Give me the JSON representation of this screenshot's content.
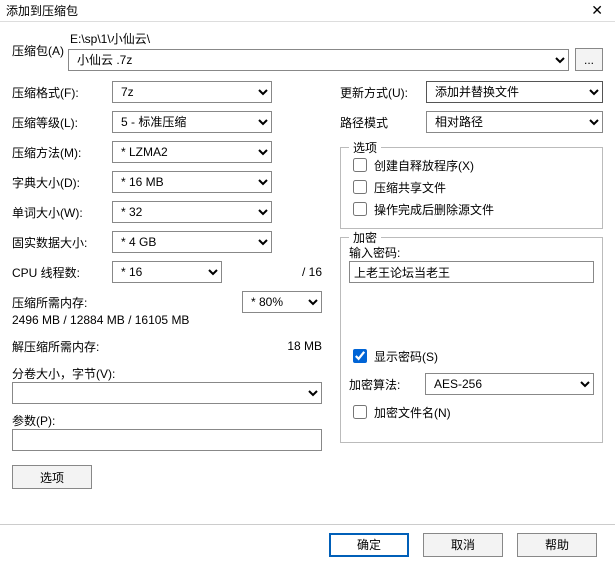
{
  "window": {
    "title": "添加到压缩包"
  },
  "archive": {
    "label": "压缩包(A)",
    "path_text": "E:\\sp\\1\\小仙云\\",
    "filename": "小仙云 .7z",
    "browse_label": "..."
  },
  "left": {
    "format_label": "压缩格式(F):",
    "format_val": "7z",
    "level_label": "压缩等级(L):",
    "level_val": "5 - 标准压缩",
    "method_label": "压缩方法(M):",
    "method_val": "* LZMA2",
    "dict_label": "字典大小(D):",
    "dict_val": "* 16 MB",
    "word_label": "单词大小(W):",
    "word_val": "* 32",
    "solid_label": "固实数据大小:",
    "solid_val": "* 4 GB",
    "cpu_label": "CPU 线程数:",
    "cpu_val": "* 16",
    "cpu_total": "/ 16",
    "mem_comp_label": "压缩所需内存:",
    "mem_comp_sel": "* 80%",
    "mem_comp_line": "2496 MB / 12884 MB / 16105 MB",
    "mem_decomp_label": "解压缩所需内存:",
    "mem_decomp_val": "18 MB",
    "split_label": "分卷大小，字节(V):",
    "split_val": "",
    "params_label": "参数(P):",
    "params_val": "",
    "options_btn": "选项"
  },
  "right": {
    "update_label": "更新方式(U):",
    "update_val": "添加并替换文件",
    "pathmode_label": "路径模式",
    "pathmode_val": "相对路径",
    "group_options": "选项",
    "sfx_label": "创建自释放程序(X)",
    "shared_label": "压缩共享文件",
    "delete_label": "操作完成后删除源文件",
    "group_encrypt": "加密",
    "pwd_label": "输入密码:",
    "pwd_val": "上老王论坛当老王",
    "show_pwd_label": "显示密码(S)",
    "algo_label": "加密算法:",
    "algo_val": "AES-256",
    "encrypt_names_label": "加密文件名(N)"
  },
  "footer": {
    "ok": "确定",
    "cancel": "取消",
    "help": "帮助"
  }
}
